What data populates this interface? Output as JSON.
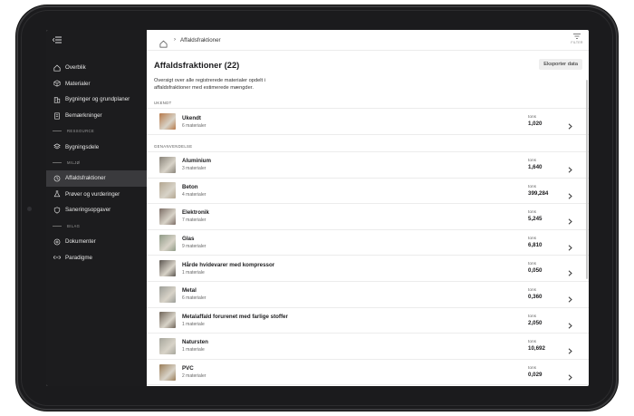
{
  "sidebar": {
    "items_top": [
      {
        "label": "Overblik",
        "icon": "home-icon"
      },
      {
        "label": "Materialer",
        "icon": "cube-icon"
      },
      {
        "label": "Bygninger og grundplaner",
        "icon": "building-icon"
      },
      {
        "label": "Bemærkninger",
        "icon": "note-icon"
      }
    ],
    "section_ressource": "RESSOURCE",
    "items_ressource": [
      {
        "label": "Bygningsdele",
        "icon": "layers-icon"
      }
    ],
    "section_miljo": "MILJØ",
    "items_miljo": [
      {
        "label": "Affaldsfraktioner",
        "icon": "recycle-icon",
        "active": true
      },
      {
        "label": "Prøver og vurderinger",
        "icon": "flask-icon"
      },
      {
        "label": "Saneringsopgaver",
        "icon": "shield-icon"
      }
    ],
    "section_bilag": "BILAG",
    "items_bilag": [
      {
        "label": "Dokumenter",
        "icon": "plus-circle-icon"
      },
      {
        "label": "Paradigme",
        "icon": "link-icon"
      }
    ]
  },
  "topbar": {
    "breadcrumb": "Affaldsfraktioner",
    "filter_label": "FILTER"
  },
  "header": {
    "title": "Affaldsfraktioner (22)",
    "export_label": "Eksporter data",
    "description": "Oversigt over alle registrerede materialer opdelt i affaldsfraktioner med estimerede mængder."
  },
  "groups": [
    {
      "label": "UKENDT",
      "rows": [
        {
          "name": "Ukendt",
          "count": "6 materialer",
          "unit": "tons",
          "value": "1,020",
          "thumb": "#b77a4a"
        }
      ]
    },
    {
      "label": "GENANVENDELSE",
      "rows": [
        {
          "name": "Aluminium",
          "count": "3 materialer",
          "unit": "tons",
          "value": "1,640",
          "thumb": "#8a847a"
        },
        {
          "name": "Beton",
          "count": "4 materialer",
          "unit": "tons",
          "value": "399,284",
          "thumb": "#b3a690"
        },
        {
          "name": "Elektronik",
          "count": "7 materialer",
          "unit": "tons",
          "value": "5,245",
          "thumb": "#7d6e66"
        },
        {
          "name": "Glas",
          "count": "9 materialer",
          "unit": "tons",
          "value": "6,810",
          "thumb": "#8f9a86"
        },
        {
          "name": "Hårde hvidevarer med kompressor",
          "count": "1 materiale",
          "unit": "tons",
          "value": "0,050",
          "thumb": "#5c5650"
        },
        {
          "name": "Metal",
          "count": "6 materialer",
          "unit": "tons",
          "value": "0,360",
          "thumb": "#9c9e98"
        },
        {
          "name": "Metalaffald forurenet med farlige stoffer",
          "count": "1 materiale",
          "unit": "tons",
          "value": "2,050",
          "thumb": "#6f6458"
        },
        {
          "name": "Natursten",
          "count": "1 materiale",
          "unit": "tons",
          "value": "10,692",
          "thumb": "#a6a69c"
        },
        {
          "name": "PVC",
          "count": "2 materialer",
          "unit": "tons",
          "value": "0,029",
          "thumb": "#9a7d58"
        }
      ]
    }
  ],
  "colors": {
    "sidebar_bg": "#1c1c1e",
    "sidebar_active": "#3a3a3d",
    "bezel": "#1b1b1d"
  }
}
